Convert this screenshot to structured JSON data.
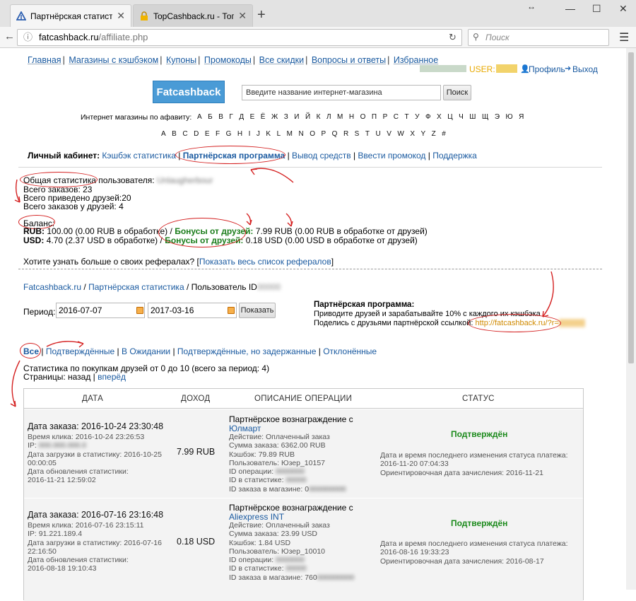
{
  "browser": {
    "tabs": [
      {
        "title": "Партнёрская статистика",
        "active": true
      },
      {
        "title": "TopCashback.ru - Топ лу...",
        "active": false
      }
    ],
    "url_host": "fatcashback.ru",
    "url_path": "/affiliate.php",
    "search_placeholder": "Поиск"
  },
  "nav": {
    "items": [
      "Главная",
      "Магазины с кэшбэком",
      "Купоны",
      "Промокоды",
      "Все скидки",
      "Вопросы и ответы",
      "Избранное"
    ],
    "user_label": "USER:",
    "profile": "Профиль",
    "logout": "Выход"
  },
  "header": {
    "logo": "Fatcashback",
    "shop_search_value": "Введите название интернет-магазина",
    "search_button": "Поиск",
    "alpha_label": "Интернет магазины по афавиту:",
    "alpha_ru": [
      "А",
      "Б",
      "В",
      "Г",
      "Д",
      "Е",
      "Ё",
      "Ж",
      "З",
      "И",
      "Й",
      "К",
      "Л",
      "М",
      "Н",
      "О",
      "П",
      "Р",
      "С",
      "Т",
      "У",
      "Ф",
      "Х",
      "Ц",
      "Ч",
      "Ш",
      "Щ",
      "Э",
      "Ю",
      "Я"
    ],
    "alpha_en": [
      "A",
      "B",
      "C",
      "D",
      "E",
      "F",
      "G",
      "H",
      "I",
      "J",
      "K",
      "L",
      "M",
      "N",
      "O",
      "P",
      "Q",
      "R",
      "S",
      "T",
      "U",
      "V",
      "W",
      "X",
      "Y",
      "Z",
      "#"
    ]
  },
  "cabinet": {
    "label": "Личный кабинет:",
    "links": [
      "Кэшбэк статистика",
      "Партнёрская программа",
      "Вывод средств",
      "Ввести промокод",
      "Поддержка"
    ]
  },
  "stats": {
    "title": "Общая статистика пользователя:",
    "orders": "Всего заказов: 23",
    "friends": "Всего приведено друзей:20",
    "friend_orders": "Всего заказов у друзей: 4",
    "balance_title": "Баланс:",
    "rub_label": "RUB:",
    "rub_text": "100.00 (0.00 RUB в обработке) /",
    "rub_bonus_label": "Бонусы от друзей:",
    "rub_bonus": "7.99 RUB (0.00 RUB в обработке от друзей)",
    "usd_label": "USD:",
    "usd_text": "4.70 (2.37 USD в обработке) /",
    "usd_bonus_label": "Бонусы от друзей:",
    "usd_bonus": "0.18 USD (0.00 USD в обработке от друзей)",
    "more_text": "Хотите узнать больше о своих рефералах? [",
    "more_link": "Показать весь список рефералов",
    "more_end": "]"
  },
  "breadcrumb": {
    "home": "Fatcashback.ru",
    "section": "Партнёрская статистика",
    "current": "Пользователь ID"
  },
  "period": {
    "label": "Период:",
    "from": "2016-07-07",
    "to": "2017-03-16",
    "button": "Показать"
  },
  "partner": {
    "title": "Партнёрская программа:",
    "line1": "Приводите друзей и зарабатывайте 10% с каждого их кэшбэка",
    "line2": "Поделись с друзьями партнёрской ссылкой:",
    "link": "http://fatcashback.ru/?r="
  },
  "filters": {
    "items": [
      "Все",
      "Подтверждённые",
      "В Ожидании",
      "Подтверждённые, но задержанные",
      "Отклонённые"
    ]
  },
  "listing": {
    "info": "Статистика по покупкам друзей от 0 до 10 (всего за период: 4)",
    "pages_label": "Страницы: назад |",
    "forward": "вперёд"
  },
  "table": {
    "headers": [
      "ДАТА",
      "ДОХОД",
      "ОПИСАНИЕ ОПЕРАЦИИ",
      "СТАТУС"
    ],
    "rows": [
      {
        "order_date": "Дата заказа: 2016-10-24 23:30:48",
        "click_time": "Время клика: 2016-10-24 23:26:53",
        "ip": "IP:",
        "load_date": "Дата загрузки в статистику: 2016-10-25",
        "load_time": "00:00:05",
        "update_label": "Дата обновления статистики:",
        "update_date": "2016-11-21 12:59:02",
        "income": "7.99 RUB",
        "desc_title": "Партнёрское вознаграждение с",
        "shop": "Юлмарт",
        "action": "Действие: Оплаченный заказ",
        "sum": "Сумма заказа: 6362.00 RUB",
        "cashback": "Кэшбэк: 79.89 RUB",
        "user": "Пользователь: Юзер_10157",
        "op_id": "ID операции:",
        "stat_id": "ID в статистике:",
        "shop_id": "ID заказа в магазине: 0",
        "status": "Подтверждён",
        "status_change": "Дата и время последнего изменения статуса платежа:",
        "status_change_date": "2016-11-20 07:04:33",
        "est_date": "Ориентировочная дата зачисления: 2016-11-21"
      },
      {
        "order_date": "Дата заказа: 2016-07-16 23:16:48",
        "click_time": "Время клика: 2016-07-16 23:15:11",
        "ip": "IP: 91.221.189.4",
        "load_date": "Дата загрузки в статистику: 2016-07-16",
        "load_time": "22:16:50",
        "update_label": "Дата обновления статистики:",
        "update_date": "2016-08-18 19:10:43",
        "income": "0.18 USD",
        "desc_title": "Партнёрское вознаграждение с",
        "shop": "Aliexpress INT",
        "action": "Действие: Оплаченный заказ",
        "sum": "Сумма заказа: 23.99 USD",
        "cashback": "Кэшбэк: 1.84 USD",
        "user": "Пользователь: Юзер_10010",
        "op_id": "ID операции:",
        "stat_id": "ID в статистике:",
        "shop_id": "ID заказа в магазине: 760",
        "status": "Подтверждён",
        "status_change": "Дата и время последнего изменения статуса платежа:",
        "status_change_date": "2016-08-16 19:33:23",
        "est_date": "Ориентировочная дата зачисления: 2016-08-17"
      }
    ]
  }
}
